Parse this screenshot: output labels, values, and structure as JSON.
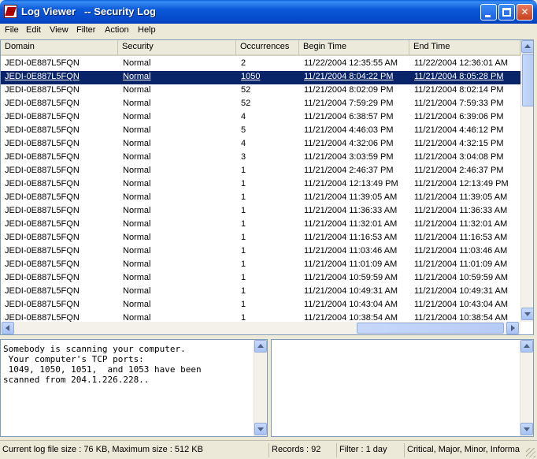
{
  "window": {
    "title": "Log Viewer   -- Security Log",
    "icon": "log-viewer-app-icon",
    "colors": {
      "titlebar": "#0548c9",
      "selection": "#0a246a",
      "close_button": "#c8401e"
    }
  },
  "controls": {
    "minimize_icon": "minimize-icon",
    "maximize_icon": "maximize-icon",
    "close_label": "✕"
  },
  "menu": [
    "File",
    "Edit",
    "View",
    "Filter",
    "Action",
    "Help"
  ],
  "table": {
    "columns": [
      "Domain",
      "Security",
      "Occurrences",
      "Begin Time",
      "End Time"
    ],
    "selected_row": 1,
    "rows": [
      [
        "JEDI-0E887L5FQN",
        "Normal",
        "2",
        "11/22/2004 12:35:55 AM",
        "11/22/2004 12:36:01 AM"
      ],
      [
        "JEDI-0E887L5FQN",
        "Normal",
        "1050",
        "11/21/2004 8:04:22 PM",
        "11/21/2004 8:05:28 PM"
      ],
      [
        "JEDI-0E887L5FQN",
        "Normal",
        "52",
        "11/21/2004 8:02:09 PM",
        "11/21/2004 8:02:14 PM"
      ],
      [
        "JEDI-0E887L5FQN",
        "Normal",
        "52",
        "11/21/2004 7:59:29 PM",
        "11/21/2004 7:59:33 PM"
      ],
      [
        "JEDI-0E887L5FQN",
        "Normal",
        "4",
        "11/21/2004 6:38:57 PM",
        "11/21/2004 6:39:06 PM"
      ],
      [
        "JEDI-0E887L5FQN",
        "Normal",
        "5",
        "11/21/2004 4:46:03 PM",
        "11/21/2004 4:46:12 PM"
      ],
      [
        "JEDI-0E887L5FQN",
        "Normal",
        "4",
        "11/21/2004 4:32:06 PM",
        "11/21/2004 4:32:15 PM"
      ],
      [
        "JEDI-0E887L5FQN",
        "Normal",
        "3",
        "11/21/2004 3:03:59 PM",
        "11/21/2004 3:04:08 PM"
      ],
      [
        "JEDI-0E887L5FQN",
        "Normal",
        "1",
        "11/21/2004 2:46:37 PM",
        "11/21/2004 2:46:37 PM"
      ],
      [
        "JEDI-0E887L5FQN",
        "Normal",
        "1",
        "11/21/2004 12:13:49 PM",
        "11/21/2004 12:13:49 PM"
      ],
      [
        "JEDI-0E887L5FQN",
        "Normal",
        "1",
        "11/21/2004 11:39:05 AM",
        "11/21/2004 11:39:05 AM"
      ],
      [
        "JEDI-0E887L5FQN",
        "Normal",
        "1",
        "11/21/2004 11:36:33 AM",
        "11/21/2004 11:36:33 AM"
      ],
      [
        "JEDI-0E887L5FQN",
        "Normal",
        "1",
        "11/21/2004 11:32:01 AM",
        "11/21/2004 11:32:01 AM"
      ],
      [
        "JEDI-0E887L5FQN",
        "Normal",
        "1",
        "11/21/2004 11:16:53 AM",
        "11/21/2004 11:16:53 AM"
      ],
      [
        "JEDI-0E887L5FQN",
        "Normal",
        "1",
        "11/21/2004 11:03:46 AM",
        "11/21/2004 11:03:46 AM"
      ],
      [
        "JEDI-0E887L5FQN",
        "Normal",
        "1",
        "11/21/2004 11:01:09 AM",
        "11/21/2004 11:01:09 AM"
      ],
      [
        "JEDI-0E887L5FQN",
        "Normal",
        "1",
        "11/21/2004 10:59:59 AM",
        "11/21/2004 10:59:59 AM"
      ],
      [
        "JEDI-0E887L5FQN",
        "Normal",
        "1",
        "11/21/2004 10:49:31 AM",
        "11/21/2004 10:49:31 AM"
      ],
      [
        "JEDI-0E887L5FQN",
        "Normal",
        "1",
        "11/21/2004 10:43:04 AM",
        "11/21/2004 10:43:04 AM"
      ],
      [
        "JEDI-0E887L5FQN",
        "Normal",
        "1",
        "11/21/2004 10:38:54 AM",
        "11/21/2004 10:38:54 AM"
      ]
    ]
  },
  "detail": {
    "message": "Somebody is scanning your computer.\n Your computer's TCP ports:\n 1049, 1050, 1051,  and 1053 have been\nscanned from 204.1.226.228..",
    "secondary": ""
  },
  "status": {
    "log_size": "Current log file size : 76 KB, Maximum size : 512 KB",
    "records": "Records : 92",
    "filter": "Filter : 1 day",
    "severity": "Critical, Major, Minor, Informa"
  }
}
